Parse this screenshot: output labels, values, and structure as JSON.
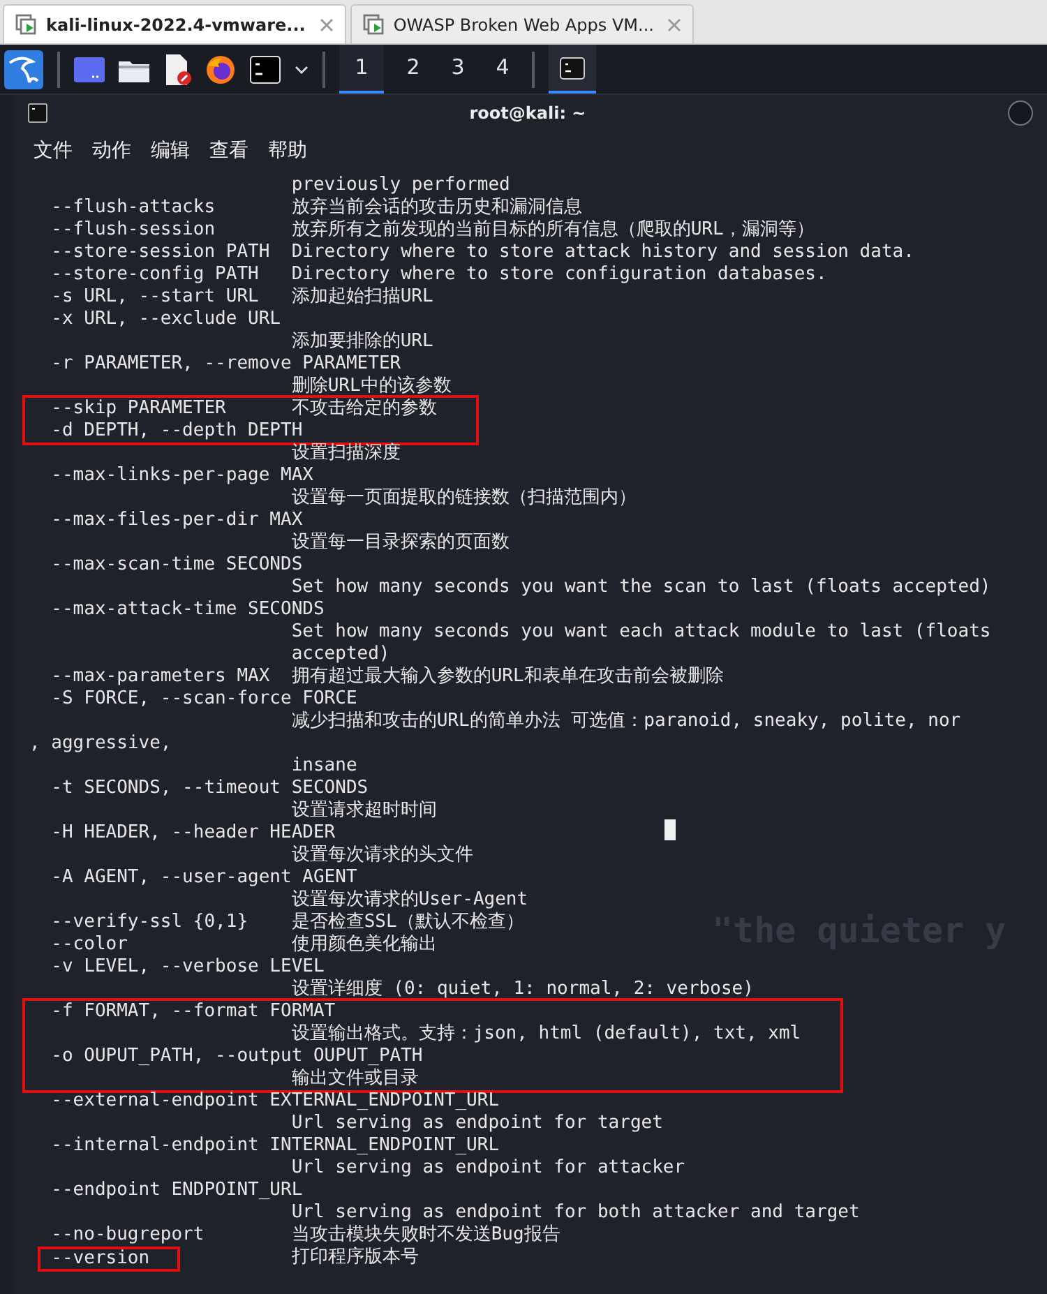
{
  "browser_tabs": [
    {
      "title": "kali-linux-2022.4-vmware...",
      "selected": true
    },
    {
      "title": "OWASP Broken Web Apps VM...",
      "selected": false
    }
  ],
  "panel": {
    "workspaces": [
      {
        "label": "1",
        "selected": true
      },
      {
        "label": "2",
        "selected": false
      },
      {
        "label": "3",
        "selected": false
      },
      {
        "label": "4",
        "selected": false
      }
    ],
    "tasks": [
      {
        "selected": true
      }
    ]
  },
  "wallpaper_text": "\"the quieter y",
  "terminal": {
    "title": "root@kali: ~",
    "menu": [
      "文件",
      "动作",
      "编辑",
      "查看",
      "帮助"
    ],
    "blocks": [
      {
        "kind": "plain",
        "lines": [
          {
            "description": "previously performed"
          },
          {
            "option": "--flush-attacks",
            "description": "放弃当前会话的攻击历史和漏洞信息"
          },
          {
            "option": "--flush-session",
            "description": "放弃所有之前发现的当前目标的所有信息（爬取的URL，漏洞等）"
          },
          {
            "option": "--store-session PATH",
            "description": "Directory where to store attack history and session data."
          },
          {
            "option": "--store-config PATH",
            "description": "Directory where to store configuration databases."
          },
          {
            "option": "-s URL, --start URL",
            "description": "添加起始扫描URL"
          },
          {
            "option": "-x URL, --exclude URL"
          },
          {
            "description": "添加要排除的URL"
          },
          {
            "option": "-r PARAMETER, --remove PARAMETER"
          },
          {
            "description": "删除URL中的该参数"
          }
        ]
      },
      {
        "kind": "boxed",
        "lines": [
          {
            "option": "--skip PARAMETER",
            "description": "不攻击给定的参数"
          },
          {
            "option": "-d DEPTH, --depth DEPTH"
          }
        ]
      },
      {
        "kind": "plain",
        "lines": [
          {
            "description": "设置扫描深度"
          },
          {
            "option": "--max-links-per-page MAX"
          },
          {
            "description": "设置每一页面提取的链接数（扫描范围内）"
          },
          {
            "option": "--max-files-per-dir MAX"
          },
          {
            "description": "设置每一目录探索的页面数"
          },
          {
            "option": "--max-scan-time SECONDS"
          },
          {
            "description": "Set how many seconds you want the scan to last (floats accepted)"
          },
          {
            "option": "--max-attack-time SECONDS"
          },
          {
            "description": "Set how many seconds you want each attack module to last (floats"
          },
          {
            "description": "accepted)"
          },
          {
            "option": "--max-parameters MAX",
            "description": "拥有超过最大输入参数的URL和表单在攻击前会被删除"
          },
          {
            "option": "-S FORCE, --scan-force FORCE"
          },
          {
            "description": "减少扫描和攻击的URL的简单办法 可选值：paranoid, sneaky, polite, nor"
          },
          {
            "text": ", aggressive,"
          },
          {
            "description": "insane"
          },
          {
            "option": "-t SECONDS, --timeout SECONDS"
          },
          {
            "description": "设置请求超时时间"
          },
          {
            "option": "-H HEADER, --header HEADER"
          },
          {
            "description": "设置每次请求的头文件"
          },
          {
            "option": "-A AGENT, --user-agent AGENT"
          },
          {
            "description": "设置每次请求的User-Agent"
          },
          {
            "option": "--verify-ssl {0,1}",
            "description": "是否检查SSL（默认不检查）"
          },
          {
            "option": "--color",
            "description": "使用颜色美化输出"
          },
          {
            "option": "-v LEVEL, --verbose LEVEL"
          },
          {
            "description": "设置详细度 (0: quiet, 1: normal, 2: verbose)"
          }
        ]
      },
      {
        "kind": "boxed",
        "lines": [
          {
            "option": "-f FORMAT, --format FORMAT"
          },
          {
            "description": "设置输出格式。支持：json, html (default), txt, xml"
          },
          {
            "option": "-o OUPUT_PATH, --output OUPUT_PATH"
          },
          {
            "description": "输出文件或目录"
          }
        ]
      },
      {
        "kind": "plain",
        "lines": [
          {
            "option": "--external-endpoint EXTERNAL_ENDPOINT_URL"
          },
          {
            "description": "Url serving as endpoint for target"
          },
          {
            "option": "--internal-endpoint INTERNAL_ENDPOINT_URL"
          },
          {
            "description": "Url serving as endpoint for attacker"
          },
          {
            "option": "--endpoint ENDPOINT_URL"
          },
          {
            "description": "Url serving as endpoint for both attacker and target"
          },
          {
            "option": "--no-bugreport",
            "description": "当攻击模块失败时不发送Bug报告"
          }
        ]
      },
      {
        "kind": "boxed_option",
        "lines": [
          {
            "option": "--version",
            "description": "打印程序版本号"
          }
        ]
      }
    ]
  }
}
